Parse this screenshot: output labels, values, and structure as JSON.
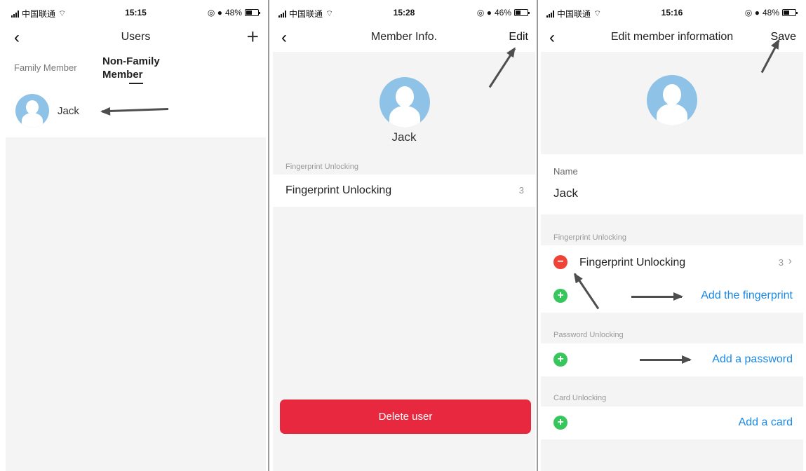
{
  "screen1": {
    "status": {
      "carrier": "中国联通",
      "time": "15:15",
      "battery": "48%",
      "battery_level": 0.48
    },
    "nav": {
      "title": "Users"
    },
    "tabs": [
      {
        "label": "Family Member"
      },
      {
        "label": "Non-Family Member",
        "line1": "Non-Family",
        "line2": "Member"
      }
    ],
    "users": [
      {
        "name": "Jack"
      }
    ]
  },
  "screen2": {
    "status": {
      "carrier": "中国联通",
      "time": "15:28",
      "battery": "46%",
      "battery_level": 0.46
    },
    "nav": {
      "title": "Member Info.",
      "action": "Edit"
    },
    "profile_name": "Jack",
    "section_label": "Fingerprint Unlocking",
    "fingerprint_row": {
      "label": "Fingerprint Unlocking",
      "count": "3"
    },
    "delete_label": "Delete user"
  },
  "screen3": {
    "status": {
      "carrier": "中国联通",
      "time": "15:16",
      "battery": "48%",
      "battery_level": 0.48
    },
    "nav": {
      "title": "Edit member information",
      "action": "Save"
    },
    "name_label": "Name",
    "name_value": "Jack",
    "fingerprint_section": "Fingerprint Unlocking",
    "fingerprint_row": {
      "label": "Fingerprint Unlocking",
      "count": "3"
    },
    "add_fingerprint": "Add the fingerprint",
    "password_section": "Password Unlocking",
    "add_password": "Add a password",
    "card_section": "Card Unlocking",
    "add_card": "Add a card"
  },
  "colors": {
    "accent_blue": "#1a88e6",
    "delete_red": "#e8283e",
    "minus_red": "#ee4336",
    "plus_green": "#36c65b",
    "avatar_blue": "#8ec2e6"
  },
  "icons": [
    "signal-icon",
    "wifi-icon",
    "alarm-icon",
    "battery-icon",
    "back-icon",
    "plus-icon",
    "avatar-icon",
    "minus-icon",
    "chevron-right-icon",
    "arrow-annotation"
  ]
}
